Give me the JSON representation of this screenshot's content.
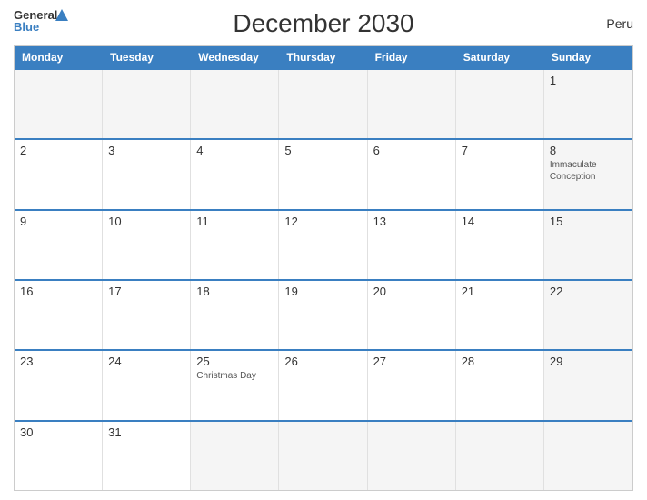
{
  "header": {
    "title": "December 2030",
    "country": "Peru"
  },
  "logo": {
    "general": "General",
    "blue": "Blue"
  },
  "days": [
    "Monday",
    "Tuesday",
    "Wednesday",
    "Thursday",
    "Friday",
    "Saturday",
    "Sunday"
  ],
  "weeks": [
    [
      {
        "num": "",
        "empty": true
      },
      {
        "num": "",
        "empty": true
      },
      {
        "num": "",
        "empty": true
      },
      {
        "num": "",
        "empty": true
      },
      {
        "num": "",
        "empty": true
      },
      {
        "num": "",
        "empty": true
      },
      {
        "num": "1",
        "event": ""
      }
    ],
    [
      {
        "num": "2",
        "event": ""
      },
      {
        "num": "3",
        "event": ""
      },
      {
        "num": "4",
        "event": ""
      },
      {
        "num": "5",
        "event": ""
      },
      {
        "num": "6",
        "event": ""
      },
      {
        "num": "7",
        "event": ""
      },
      {
        "num": "8",
        "event": "Immaculate Conception"
      }
    ],
    [
      {
        "num": "9",
        "event": ""
      },
      {
        "num": "10",
        "event": ""
      },
      {
        "num": "11",
        "event": ""
      },
      {
        "num": "12",
        "event": ""
      },
      {
        "num": "13",
        "event": ""
      },
      {
        "num": "14",
        "event": ""
      },
      {
        "num": "15",
        "event": ""
      }
    ],
    [
      {
        "num": "16",
        "event": ""
      },
      {
        "num": "17",
        "event": ""
      },
      {
        "num": "18",
        "event": ""
      },
      {
        "num": "19",
        "event": ""
      },
      {
        "num": "20",
        "event": ""
      },
      {
        "num": "21",
        "event": ""
      },
      {
        "num": "22",
        "event": ""
      }
    ],
    [
      {
        "num": "23",
        "event": ""
      },
      {
        "num": "24",
        "event": ""
      },
      {
        "num": "25",
        "event": "Christmas Day"
      },
      {
        "num": "26",
        "event": ""
      },
      {
        "num": "27",
        "event": ""
      },
      {
        "num": "28",
        "event": ""
      },
      {
        "num": "29",
        "event": ""
      }
    ],
    [
      {
        "num": "30",
        "event": ""
      },
      {
        "num": "31",
        "event": ""
      },
      {
        "num": "",
        "empty": true
      },
      {
        "num": "",
        "empty": true
      },
      {
        "num": "",
        "empty": true
      },
      {
        "num": "",
        "empty": true
      },
      {
        "num": "",
        "empty": true
      }
    ]
  ]
}
